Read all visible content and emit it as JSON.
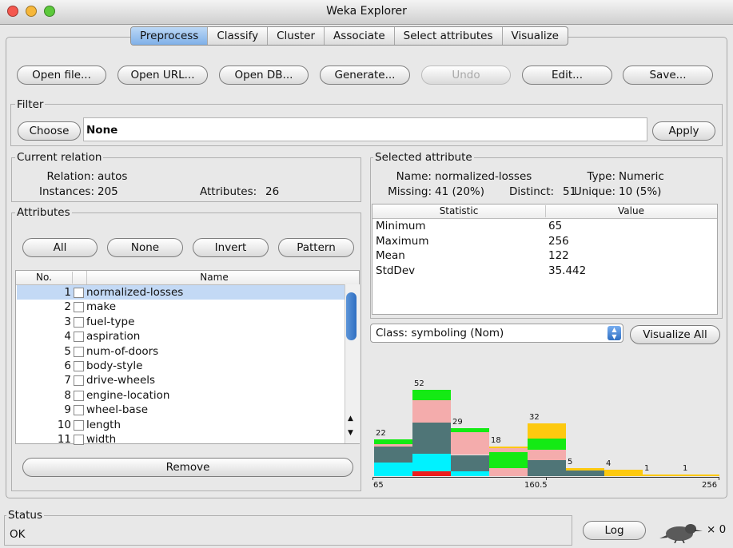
{
  "window": {
    "title": "Weka Explorer"
  },
  "tabs": [
    "Preprocess",
    "Classify",
    "Cluster",
    "Associate",
    "Select attributes",
    "Visualize"
  ],
  "toolbar": {
    "open_file": "Open file...",
    "open_url": "Open URL...",
    "open_db": "Open DB...",
    "generate": "Generate...",
    "undo": "Undo",
    "edit": "Edit...",
    "save": "Save..."
  },
  "filter": {
    "label": "Filter",
    "choose": "Choose",
    "value": "None",
    "apply": "Apply"
  },
  "relation": {
    "label": "Current relation",
    "relation_label": "Relation:",
    "relation": "autos",
    "instances_label": "Instances:",
    "instances": "205",
    "attributes_label": "Attributes:",
    "attributes": "26"
  },
  "attributes": {
    "label": "Attributes",
    "buttons": {
      "all": "All",
      "none": "None",
      "invert": "Invert",
      "pattern": "Pattern"
    },
    "col_no": "No.",
    "col_name": "Name",
    "rows": [
      {
        "no": "1",
        "name": "normalized-losses"
      },
      {
        "no": "2",
        "name": "make"
      },
      {
        "no": "3",
        "name": "fuel-type"
      },
      {
        "no": "4",
        "name": "aspiration"
      },
      {
        "no": "5",
        "name": "num-of-doors"
      },
      {
        "no": "6",
        "name": "body-style"
      },
      {
        "no": "7",
        "name": "drive-wheels"
      },
      {
        "no": "8",
        "name": "engine-location"
      },
      {
        "no": "9",
        "name": "wheel-base"
      },
      {
        "no": "10",
        "name": "length"
      },
      {
        "no": "11",
        "name": "width"
      }
    ],
    "remove": "Remove"
  },
  "selected": {
    "label": "Selected attribute",
    "name_label": "Name:",
    "name": "normalized-losses",
    "type_label": "Type:",
    "type": "Numeric",
    "missing_label": "Missing:",
    "missing": "41 (20%)",
    "distinct_label": "Distinct:",
    "distinct": "51",
    "unique_label": "Unique:",
    "unique": "10 (5%)",
    "col_stat": "Statistic",
    "col_value": "Value",
    "stats": [
      {
        "stat": "Minimum",
        "value": "65"
      },
      {
        "stat": "Maximum",
        "value": "256"
      },
      {
        "stat": "Mean",
        "value": "122"
      },
      {
        "stat": "StdDev",
        "value": "35.442"
      }
    ]
  },
  "class_select": {
    "value": "Class: symboling (Nom)",
    "visualize_all": "Visualize All"
  },
  "histogram": {
    "axis_labels": [
      "65",
      "160.5",
      "256"
    ],
    "class_colors": {
      "red": "#ee1c1c",
      "cyan": "#00f2ff",
      "slate": "#4f7577",
      "pink": "#f4acac",
      "green": "#14ea14",
      "yellow": "#fdc90f"
    },
    "bins": [
      {
        "count": "22",
        "segments": [
          {
            "c": "cyan",
            "v": 0.38
          },
          {
            "c": "slate",
            "v": 0.42
          },
          {
            "c": "pink",
            "v": 0.08
          },
          {
            "c": "green",
            "v": 0.12
          }
        ]
      },
      {
        "count": "52",
        "segments": [
          {
            "c": "red",
            "v": 0.06
          },
          {
            "c": "cyan",
            "v": 0.2
          },
          {
            "c": "slate",
            "v": 0.36
          },
          {
            "c": "pink",
            "v": 0.26
          },
          {
            "c": "green",
            "v": 0.12
          }
        ]
      },
      {
        "count": "29",
        "segments": [
          {
            "c": "cyan",
            "v": 0.1
          },
          {
            "c": "slate",
            "v": 0.34
          },
          {
            "c": "pink",
            "v": 0.48
          },
          {
            "c": "green",
            "v": 0.08
          }
        ]
      },
      {
        "count": "18",
        "segments": [
          {
            "c": "pink",
            "v": 0.28
          },
          {
            "c": "green",
            "v": 0.52
          },
          {
            "c": "pink",
            "v": 0.13
          },
          {
            "c": "yellow",
            "v": 0.07
          }
        ]
      },
      {
        "count": "32",
        "segments": [
          {
            "c": "slate",
            "v": 0.3
          },
          {
            "c": "pink",
            "v": 0.2
          },
          {
            "c": "green",
            "v": 0.2
          },
          {
            "c": "yellow",
            "v": 0.3
          }
        ]
      },
      {
        "count": "5",
        "segments": [
          {
            "c": "slate",
            "v": 0.7
          },
          {
            "c": "yellow",
            "v": 0.3
          }
        ]
      },
      {
        "count": "4",
        "segments": [
          {
            "c": "yellow",
            "v": 1.0
          }
        ]
      },
      {
        "count": "1",
        "segments": [
          {
            "c": "yellow",
            "v": 1.0
          }
        ]
      },
      {
        "count": "1",
        "segments": [
          {
            "c": "yellow",
            "v": 1.0
          }
        ]
      }
    ]
  },
  "status": {
    "label": "Status",
    "text": "OK",
    "log": "Log",
    "count": "× 0"
  }
}
